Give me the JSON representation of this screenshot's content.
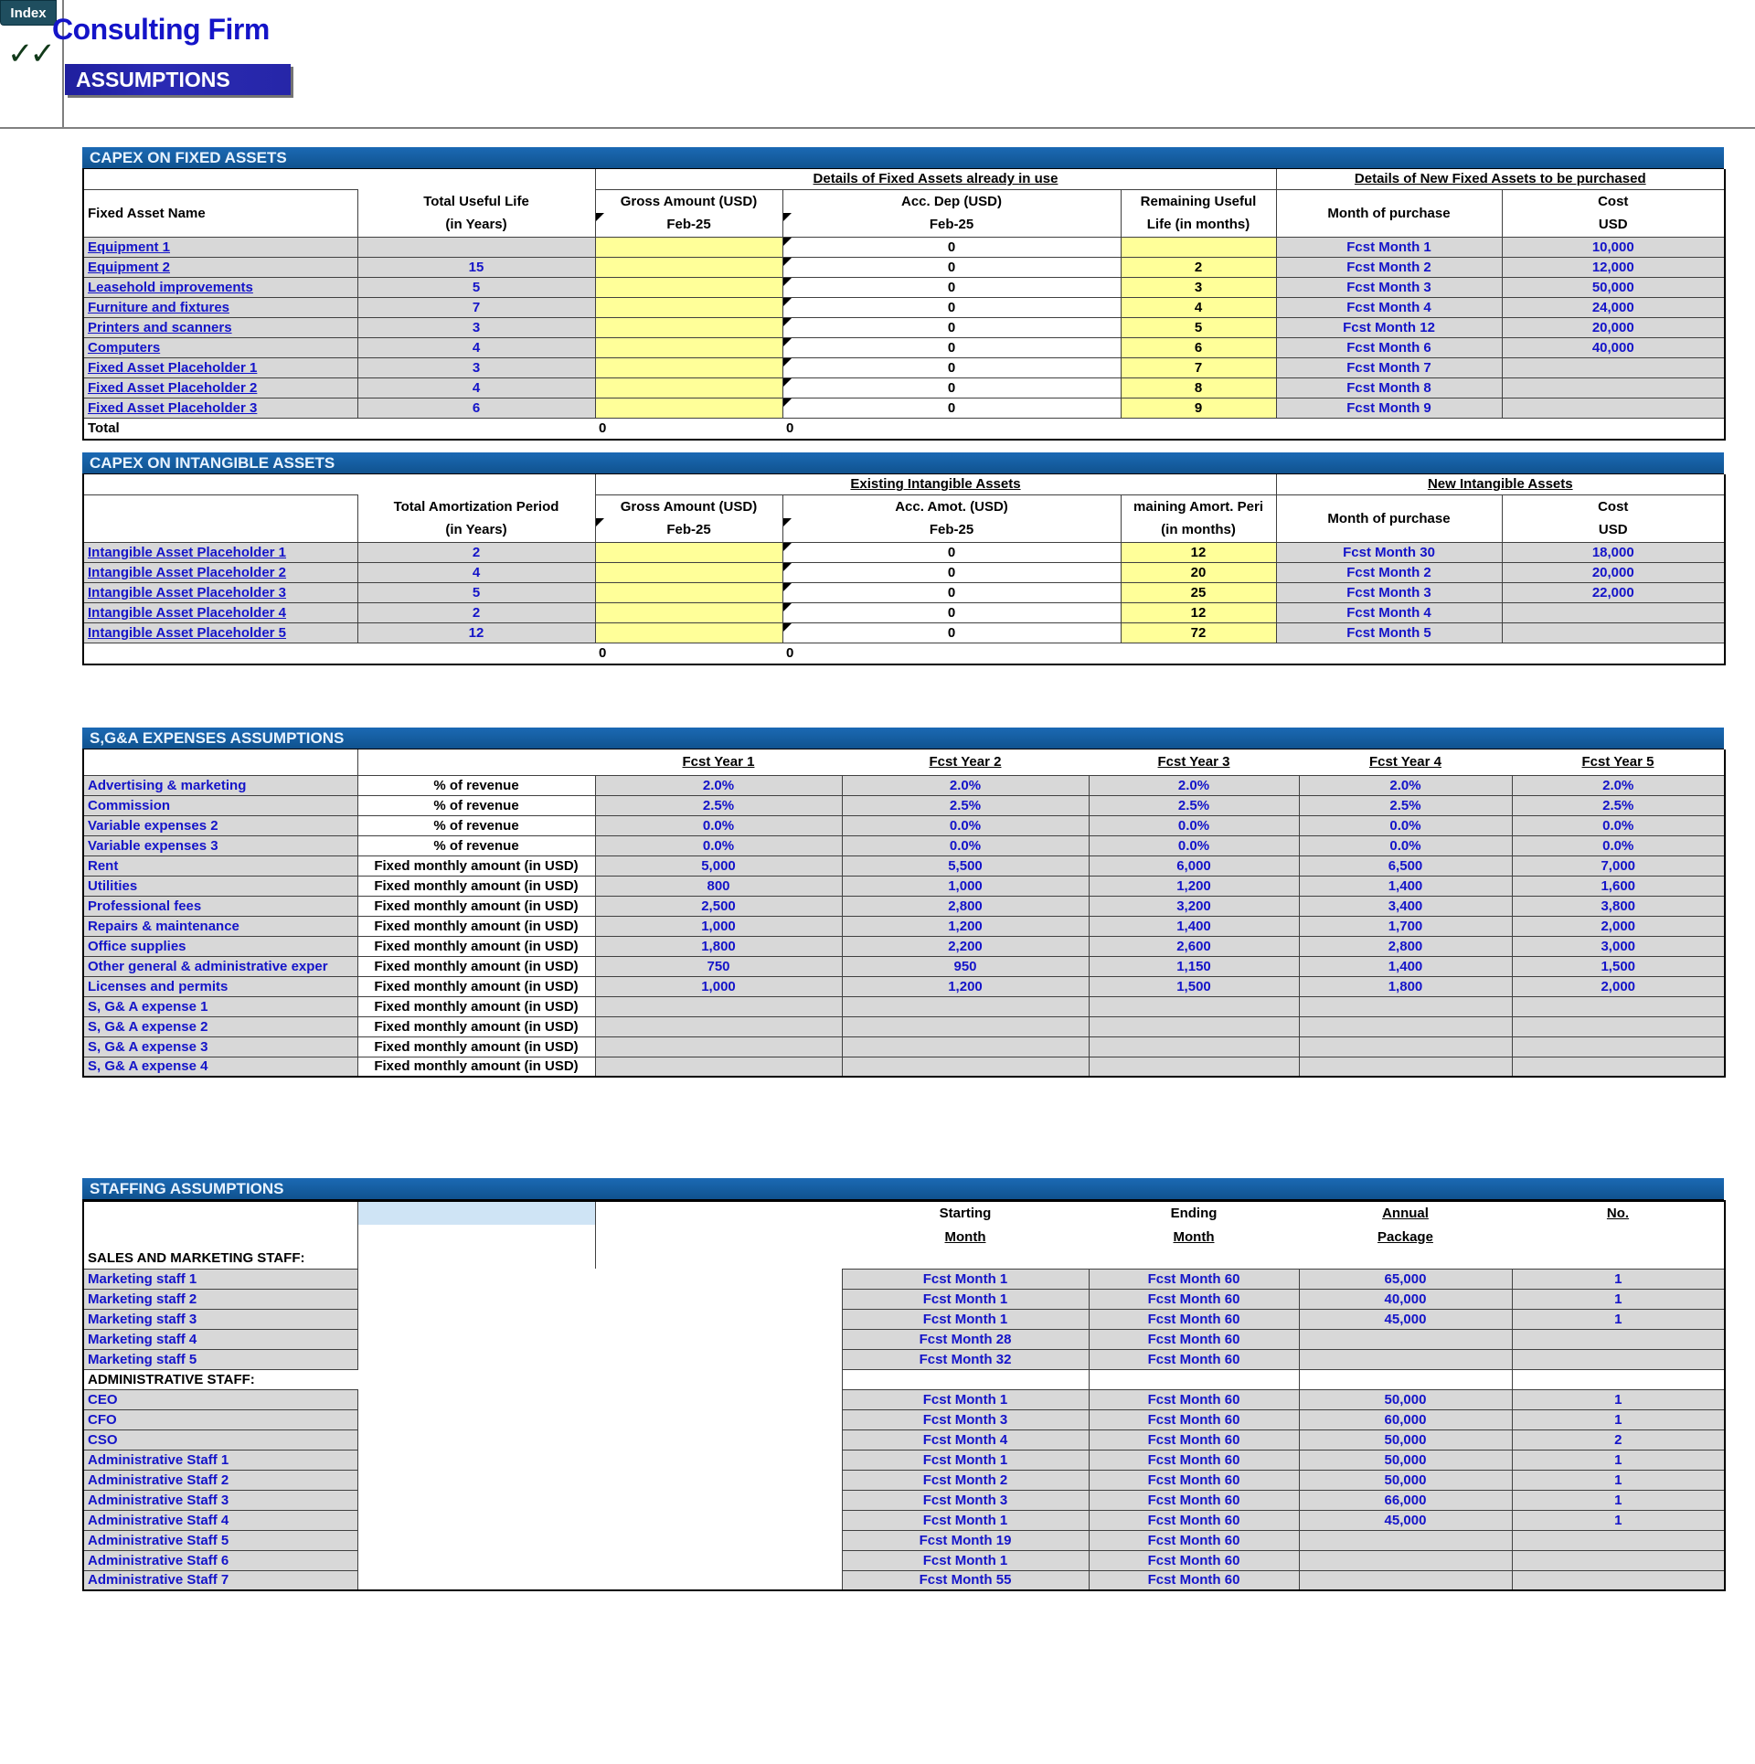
{
  "window": {
    "index_tab": "Index",
    "check_marks": "✓✓",
    "firm_title": "Consulting Firm",
    "assumptions_banner": "ASSUMPTIONS"
  },
  "capex_fixed": {
    "band": "CAPEX ON FIXED ASSETS",
    "group_existing": "Details of Fixed Assets already in use",
    "group_new": "Details of New Fixed Assets to be purchased",
    "headers": {
      "name": "Fixed Asset Name",
      "life_1": "Total Useful Life",
      "life_2": "(in Years)",
      "gross_1": "Gross Amount (USD)",
      "gross_2": "Feb-25",
      "accdep_1": "Acc. Dep (USD)",
      "accdep_2": "Feb-25",
      "remaining_1": "Remaining Useful",
      "remaining_2": "Life (in months)",
      "month_purchase": "Month of purchase",
      "cost_1": "Cost",
      "cost_2": "USD"
    },
    "rows": [
      {
        "name": "Equipment 1",
        "life": "",
        "gross": "",
        "accdep": "0",
        "remaining": "",
        "month": "Fcst Month 1",
        "cost": "10,000"
      },
      {
        "name": "Equipment 2",
        "life": "15",
        "gross": "",
        "accdep": "0",
        "remaining": "2",
        "month": "Fcst Month 2",
        "cost": "12,000"
      },
      {
        "name": "Leasehold improvements",
        "life": "5",
        "gross": "",
        "accdep": "0",
        "remaining": "3",
        "month": "Fcst Month 3",
        "cost": "50,000"
      },
      {
        "name": "Furniture and fixtures",
        "life": "7",
        "gross": "",
        "accdep": "0",
        "remaining": "4",
        "month": "Fcst Month 4",
        "cost": "24,000"
      },
      {
        "name": "Printers and scanners",
        "life": "3",
        "gross": "",
        "accdep": "0",
        "remaining": "5",
        "month": "Fcst Month 12",
        "cost": "20,000"
      },
      {
        "name": "Computers",
        "life": "4",
        "gross": "",
        "accdep": "0",
        "remaining": "6",
        "month": "Fcst Month 6",
        "cost": "40,000"
      },
      {
        "name": "Fixed Asset Placeholder 1",
        "life": "3",
        "gross": "",
        "accdep": "0",
        "remaining": "7",
        "month": "Fcst Month 7",
        "cost": ""
      },
      {
        "name": "Fixed Asset Placeholder 2",
        "life": "4",
        "gross": "",
        "accdep": "0",
        "remaining": "8",
        "month": "Fcst Month 8",
        "cost": ""
      },
      {
        "name": "Fixed Asset Placeholder 3",
        "life": "6",
        "gross": "",
        "accdep": "0",
        "remaining": "9",
        "month": "Fcst Month 9",
        "cost": ""
      }
    ],
    "total_label": "Total",
    "total_gross": "0",
    "total_accdep": "0"
  },
  "capex_intangible": {
    "band": "CAPEX ON INTANGIBLE ASSETS",
    "group_existing": "Existing Intangible Assets",
    "group_new": "New Intangible Assets",
    "headers": {
      "amort_1": "Total Amortization Period",
      "amort_2": "(in Years)",
      "gross_1": "Gross Amount (USD)",
      "gross_2": "Feb-25",
      "accamot_1": "Acc. Amot. (USD)",
      "accamot_2": "Feb-25",
      "remaining_1": "maining Amort. Peri",
      "remaining_2": "(in months)",
      "month_purchase": "Month of purchase",
      "cost_1": "Cost",
      "cost_2": "USD"
    },
    "rows": [
      {
        "name": "Intangible Asset Placeholder 1",
        "period": "2",
        "gross": "",
        "accamot": "0",
        "remaining": "12",
        "month": "Fcst Month 30",
        "cost": "18,000"
      },
      {
        "name": "Intangible Asset Placeholder 2",
        "period": "4",
        "gross": "",
        "accamot": "0",
        "remaining": "20",
        "month": "Fcst Month 2",
        "cost": "20,000"
      },
      {
        "name": "Intangible Asset Placeholder 3",
        "period": "5",
        "gross": "",
        "accamot": "0",
        "remaining": "25",
        "month": "Fcst Month 3",
        "cost": "22,000"
      },
      {
        "name": "Intangible Asset Placeholder 4",
        "period": "2",
        "gross": "",
        "accamot": "0",
        "remaining": "12",
        "month": "Fcst Month 4",
        "cost": ""
      },
      {
        "name": "Intangible Asset Placeholder 5",
        "period": "12",
        "gross": "",
        "accamot": "0",
        "remaining": "72",
        "month": "Fcst Month 5",
        "cost": ""
      }
    ],
    "total_gross": "0",
    "total_accamot": "0"
  },
  "sga": {
    "band": "S,G&A EXPENSES ASSUMPTIONS",
    "year_headers": [
      "Fcst Year 1",
      "Fcst Year 2",
      "Fcst Year 3",
      "Fcst Year 4",
      "Fcst Year 5"
    ],
    "rows": [
      {
        "name": "Advertising & marketing",
        "basis": "% of revenue",
        "values": [
          "2.0%",
          "2.0%",
          "2.0%",
          "2.0%",
          "2.0%"
        ]
      },
      {
        "name": "Commission",
        "basis": "% of revenue",
        "values": [
          "2.5%",
          "2.5%",
          "2.5%",
          "2.5%",
          "2.5%"
        ]
      },
      {
        "name": "Variable expenses 2",
        "basis": "% of revenue",
        "values": [
          "0.0%",
          "0.0%",
          "0.0%",
          "0.0%",
          "0.0%"
        ]
      },
      {
        "name": "Variable expenses 3",
        "basis": "% of revenue",
        "values": [
          "0.0%",
          "0.0%",
          "0.0%",
          "0.0%",
          "0.0%"
        ]
      },
      {
        "name": "Rent",
        "basis": "Fixed monthly amount (in USD)",
        "values": [
          "5,000",
          "5,500",
          "6,000",
          "6,500",
          "7,000"
        ]
      },
      {
        "name": "Utilities",
        "basis": "Fixed monthly amount (in USD)",
        "values": [
          "800",
          "1,000",
          "1,200",
          "1,400",
          "1,600"
        ]
      },
      {
        "name": "Professional fees",
        "basis": "Fixed monthly amount (in USD)",
        "values": [
          "2,500",
          "2,800",
          "3,200",
          "3,400",
          "3,800"
        ]
      },
      {
        "name": "Repairs & maintenance",
        "basis": "Fixed monthly amount (in USD)",
        "values": [
          "1,000",
          "1,200",
          "1,400",
          "1,700",
          "2,000"
        ]
      },
      {
        "name": "Office supplies",
        "basis": "Fixed monthly amount (in USD)",
        "values": [
          "1,800",
          "2,200",
          "2,600",
          "2,800",
          "3,000"
        ]
      },
      {
        "name": "Other general & administrative exper",
        "basis": "Fixed monthly amount (in USD)",
        "values": [
          "750",
          "950",
          "1,150",
          "1,400",
          "1,500"
        ]
      },
      {
        "name": "Licenses and permits",
        "basis": "Fixed monthly amount (in USD)",
        "values": [
          "1,000",
          "1,200",
          "1,500",
          "1,800",
          "2,000"
        ]
      },
      {
        "name": "S, G& A expense 1",
        "basis": "Fixed monthly amount (in USD)",
        "values": [
          "",
          "",
          "",
          "",
          ""
        ]
      },
      {
        "name": "S, G& A expense 2",
        "basis": "Fixed monthly amount (in USD)",
        "values": [
          "",
          "",
          "",
          "",
          ""
        ]
      },
      {
        "name": "S, G& A expense 3",
        "basis": "Fixed monthly amount (in USD)",
        "values": [
          "",
          "",
          "",
          "",
          ""
        ]
      },
      {
        "name": "S, G& A expense 4",
        "basis": "Fixed monthly amount (in USD)",
        "values": [
          "",
          "",
          "",
          "",
          ""
        ]
      }
    ]
  },
  "staffing": {
    "band": "STAFFING ASSUMPTIONS",
    "headers": {
      "starting_1": "Starting",
      "starting_2": "Month",
      "ending_1": "Ending",
      "ending_2": "Month",
      "annual_1": "Annual",
      "annual_2": "Package",
      "no": "No."
    },
    "group_sales": "SALES AND MARKETING STAFF:",
    "group_admin": "ADMINISTRATIVE STAFF:",
    "sales_rows": [
      {
        "name": "Marketing staff 1",
        "start": "Fcst Month 1",
        "end": "Fcst Month 60",
        "package": "65,000",
        "no": "1"
      },
      {
        "name": "Marketing staff 2",
        "start": "Fcst Month 1",
        "end": "Fcst Month 60",
        "package": "40,000",
        "no": "1"
      },
      {
        "name": "Marketing staff 3",
        "start": "Fcst Month 1",
        "end": "Fcst Month 60",
        "package": "45,000",
        "no": "1"
      },
      {
        "name": "Marketing staff 4",
        "start": "Fcst Month 28",
        "end": "Fcst Month 60",
        "package": "",
        "no": ""
      },
      {
        "name": "Marketing staff 5",
        "start": "Fcst Month 32",
        "end": "Fcst Month 60",
        "package": "",
        "no": ""
      }
    ],
    "admin_rows": [
      {
        "name": "CEO",
        "start": "Fcst Month 1",
        "end": "Fcst Month 60",
        "package": "50,000",
        "no": "1"
      },
      {
        "name": "CFO",
        "start": "Fcst Month 3",
        "end": "Fcst Month 60",
        "package": "60,000",
        "no": "1"
      },
      {
        "name": "CSO",
        "start": "Fcst Month 4",
        "end": "Fcst Month 60",
        "package": "50,000",
        "no": "2"
      },
      {
        "name": "Administrative Staff 1",
        "start": "Fcst Month 1",
        "end": "Fcst Month 60",
        "package": "50,000",
        "no": "1"
      },
      {
        "name": "Administrative Staff 2",
        "start": "Fcst Month 2",
        "end": "Fcst Month 60",
        "package": "50,000",
        "no": "1"
      },
      {
        "name": "Administrative Staff 3",
        "start": "Fcst Month 3",
        "end": "Fcst Month 60",
        "package": "66,000",
        "no": "1"
      },
      {
        "name": "Administrative Staff 4",
        "start": "Fcst Month 1",
        "end": "Fcst Month 60",
        "package": "45,000",
        "no": "1"
      },
      {
        "name": "Administrative Staff 5",
        "start": "Fcst Month 19",
        "end": "Fcst Month 60",
        "package": "",
        "no": ""
      },
      {
        "name": "Administrative Staff 6",
        "start": "Fcst Month 1",
        "end": "Fcst Month 60",
        "package": "",
        "no": ""
      },
      {
        "name": "Administrative Staff 7",
        "start": "Fcst Month 55",
        "end": "Fcst Month 60",
        "package": "",
        "no": ""
      }
    ]
  }
}
